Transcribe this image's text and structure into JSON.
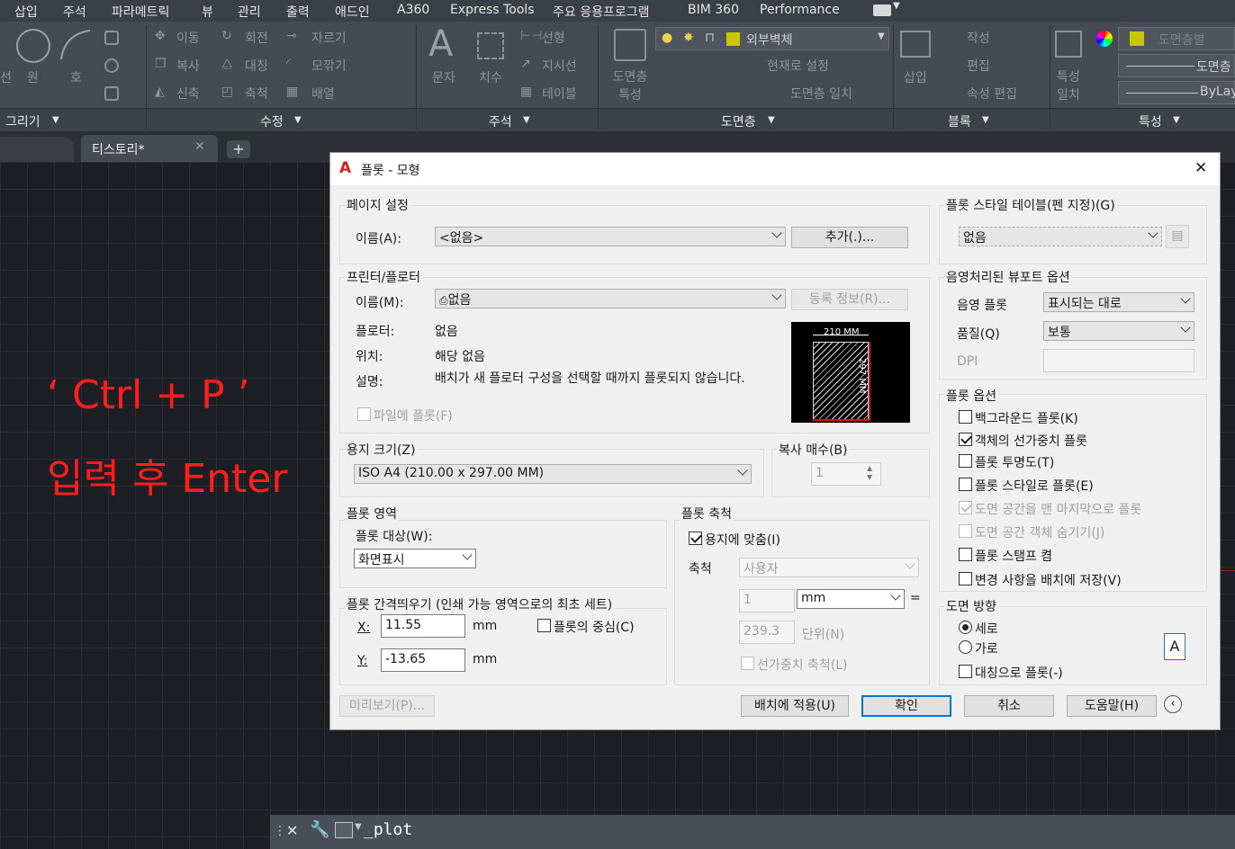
{
  "menubar": [
    "삽입",
    "주석",
    "파라메트릭",
    "뷰",
    "관리",
    "출력",
    "애드인",
    "A360",
    "Express Tools",
    "주요 응용프로그램",
    "BIM 360",
    "Performance"
  ],
  "ribbon": {
    "draw_panel": "그리기",
    "draw_tools": [
      "선",
      "원",
      "호"
    ],
    "modify_panel": "수정",
    "modify_tools": [
      "이동",
      "회전",
      "자르기",
      "복사",
      "대칭",
      "모깎기",
      "신축",
      "축척",
      "배열"
    ],
    "annotation_panel": "주석",
    "annotation_tools": [
      "문자",
      "치수",
      "선형",
      "지시선",
      "테이블"
    ],
    "layers_panel": "도면층",
    "layer_name": "외부벽체",
    "layers_tools": [
      "도면층 특성",
      "현재로 설정",
      "도면층 일치"
    ],
    "block_panel": "블록",
    "block_tools": [
      "삽입",
      "작성",
      "편집",
      "속성 편집"
    ],
    "properties_panel": "특성",
    "properties_tools": [
      "특성 일치"
    ],
    "prop_color": "도면층별",
    "prop_linetype": "도면층",
    "prop_lineweight": "ByLayer"
  },
  "tabs": {
    "active": "티스토리*",
    "add": "+"
  },
  "overlay": {
    "line1": "‘ Ctrl + P ’",
    "line2": "입력 후 Enter"
  },
  "cmdline": {
    "text": "_plot"
  },
  "dialog": {
    "title": "플롯 - 모형",
    "page_setup": {
      "group": "페이지 설정",
      "name_label": "이름(A):",
      "name_value": "<없음>",
      "add_button": "추가(.)..."
    },
    "printer": {
      "group": "프린터/플로터",
      "name_label": "이름(M):",
      "name_value": "없음",
      "properties_button": "등록 정보(R)...",
      "plotter_label": "플로터:",
      "plotter_value": "없음",
      "where_label": "위치:",
      "where_value": "해당 없음",
      "desc_label": "설명:",
      "desc_value": "배치가 새 플로터 구성을 선택할 때까지 플롯되지 않습니다.",
      "plot_to_file": "파일에 플롯(F)",
      "preview_width": "210 MM",
      "preview_height": "297 MM"
    },
    "paper_size": {
      "group": "용지 크기(Z)",
      "value": "ISO A4 (210.00 x 297.00 MM)"
    },
    "copies": {
      "group": "복사 매수(B)",
      "value": "1"
    },
    "plot_area": {
      "group": "플롯 영역",
      "what_label": "플롯 대상(W):",
      "what_value": "화면표시"
    },
    "plot_offset": {
      "group": "플롯 간격띄우기 (인쇄 가능 영역으로의 최초 세트)",
      "x_label": "X:",
      "x_value": "11.55",
      "y_label": "Y:",
      "y_value": "-13.65",
      "unit": "mm",
      "center": "플롯의 중심(C)"
    },
    "plot_scale": {
      "group": "플롯 축척",
      "fit": "용지에 맞춤(I)",
      "scale_label": "축척",
      "scale_value": "사용자",
      "val1": "1",
      "unit": "mm",
      "eq": "=",
      "val2": "239.3",
      "unit2": "단위(N)",
      "lineweights": "선가중치 축척(L)"
    },
    "style_table": {
      "group": "플롯 스타일 테이블(펜 지정)(G)",
      "value": "없음"
    },
    "shaded": {
      "group": "음영처리된 뷰포트 옵션",
      "shade_label": "음영 플롯",
      "shade_value": "표시되는 대로",
      "quality_label": "품질(Q)",
      "quality_value": "보통",
      "dpi_label": "DPI"
    },
    "options": {
      "group": "플롯 옵션",
      "items": [
        "백그라운드 플롯(K)",
        "객체의 선가중치 플롯",
        "플롯 투명도(T)",
        "플롯 스타일로 플롯(E)",
        "도면 공간을 맨 마지막으로 플롯",
        "도면 공간 객체 숨기기(J)",
        "플롯 스탬프 켬",
        "변경 사항을 배치에 저장(V)"
      ]
    },
    "orientation": {
      "group": "도면 방향",
      "portrait": "세로",
      "landscape": "가로",
      "upside": "대칭으로 플롯(-)",
      "icon_letter": "A"
    },
    "buttons": {
      "preview": "미리보기(P)...",
      "apply": "배치에 적용(U)",
      "ok": "확인",
      "cancel": "취소",
      "help": "도움말(H)"
    }
  }
}
